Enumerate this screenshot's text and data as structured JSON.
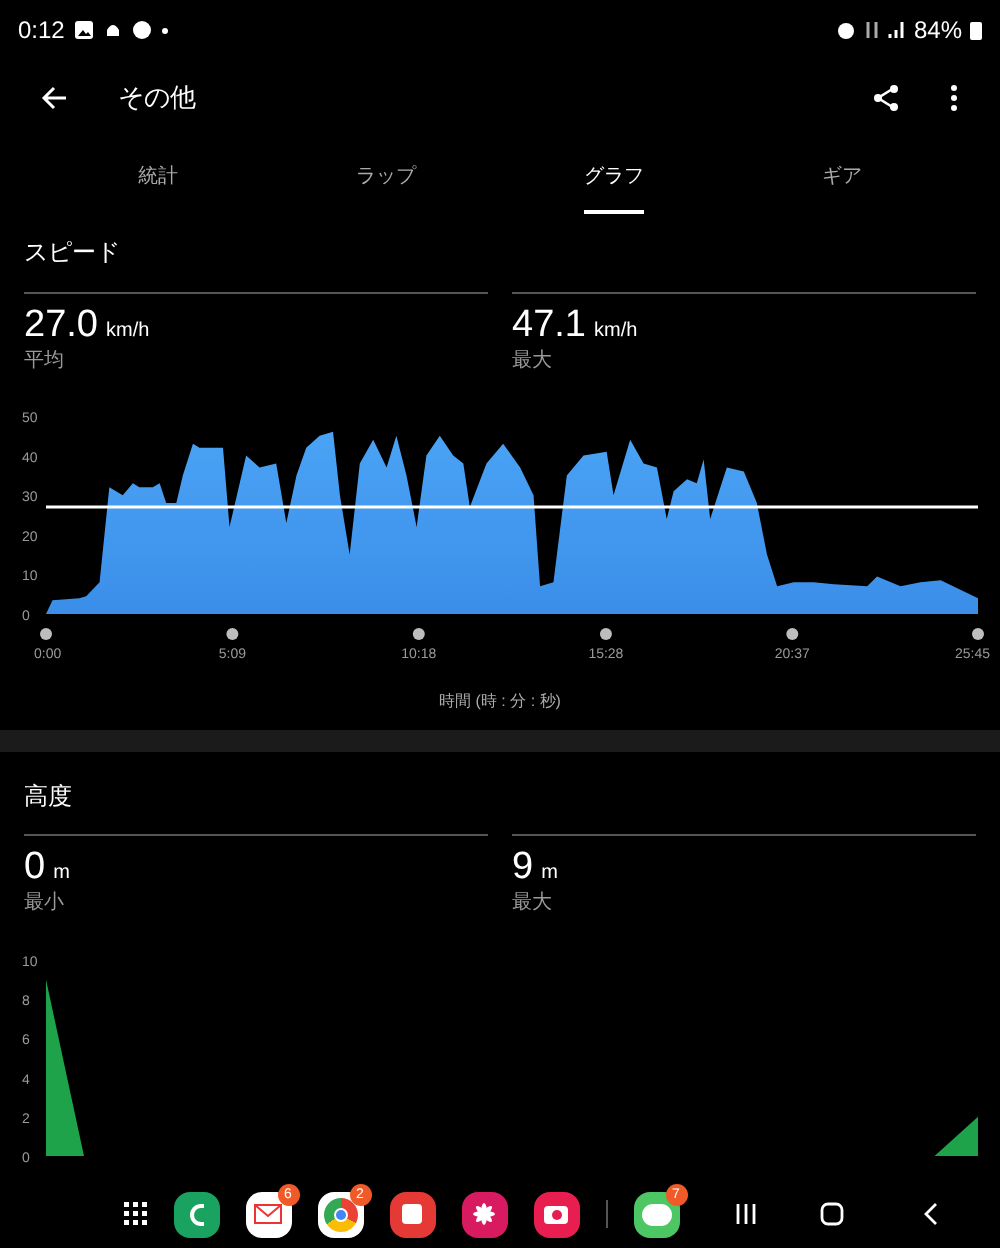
{
  "status_bar": {
    "time": "0:12",
    "battery": "84%"
  },
  "app_bar": {
    "title": "その他"
  },
  "tabs": [
    {
      "label": "統計",
      "selected": false
    },
    {
      "label": "ラップ",
      "selected": false
    },
    {
      "label": "グラフ",
      "selected": true
    },
    {
      "label": "ギア",
      "selected": false
    }
  ],
  "sections": [
    {
      "title": "スピード",
      "stats": [
        {
          "value": "27.0",
          "unit": "km/h",
          "label": "平均"
        },
        {
          "value": "47.1",
          "unit": "km/h",
          "label": "最大"
        }
      ],
      "chart_data": {
        "type": "area",
        "xlabel": "時間 (時 : 分 : 秒)",
        "ylim": [
          0,
          50
        ],
        "xlim": [
          0,
          25.75
        ],
        "yticks": [
          0,
          10,
          20,
          30,
          40,
          50
        ],
        "xticks": [
          {
            "value": 0,
            "label": "0:00"
          },
          {
            "value": 5.15,
            "label": "5:09"
          },
          {
            "value": 10.3,
            "label": "10:18"
          },
          {
            "value": 15.47,
            "label": "15:28"
          },
          {
            "value": 20.62,
            "label": "20:37"
          },
          {
            "value": 25.75,
            "label": "25:45"
          }
        ],
        "ref_lines": [
          {
            "value": 27,
            "axis": "y"
          }
        ],
        "series": [
          {
            "color": "#3b8ee8",
            "x": [
              0,
              0.18,
              0.92,
              1.11,
              1.48,
              1.75,
              2.12,
              2.4,
              2.58,
              2.95,
              3.14,
              3.32,
              3.6,
              3.78,
              4.06,
              4.24,
              4.61,
              4.89,
              5.07,
              5.53,
              5.9,
              6.36,
              6.64,
              6.92,
              7.19,
              7.56,
              7.93,
              8.12,
              8.39,
              8.67,
              9.04,
              9.41,
              9.68,
              9.96,
              10.24,
              10.51,
              10.88,
              11.25,
              11.53,
              11.71,
              12.17,
              12.63,
              13.1,
              13.47,
              13.65,
              14.02,
              14.39,
              14.85,
              15.49,
              15.68,
              16.14,
              16.51,
              16.88,
              17.15,
              17.34,
              17.71,
              17.98,
              18.17,
              18.35,
              18.81,
              19.28,
              19.64,
              19.92,
              20.2,
              20.66,
              21.21,
              21.77,
              22.69,
              22.96,
              23.61,
              24.16,
              24.72,
              25.75
            ],
            "values": [
              0,
              3.5,
              4,
              4.5,
              8,
              32,
              30,
              33,
              32,
              32,
              33,
              28,
              28,
              35,
              43,
              42,
              42,
              42,
              22,
              40,
              37,
              38,
              23,
              35,
              42,
              45,
              46,
              30,
              15,
              38,
              44,
              37,
              45,
              35,
              22,
              40,
              45,
              40,
              38,
              27,
              38,
              43,
              37,
              30,
              7,
              8,
              35,
              40,
              41,
              30,
              44,
              38,
              37,
              24,
              31,
              34,
              33,
              39,
              24,
              37,
              36,
              28,
              15,
              7,
              8,
              8,
              7.5,
              7,
              9.5,
              7,
              8,
              8.5,
              4
            ]
          }
        ]
      }
    },
    {
      "title": "高度",
      "stats": [
        {
          "value": "0",
          "unit": "m",
          "label": "最小"
        },
        {
          "value": "9",
          "unit": "m",
          "label": "最大"
        }
      ],
      "chart_data": {
        "type": "area",
        "ylim": [
          0,
          10
        ],
        "xlim": [
          0,
          25.75
        ],
        "yticks": [
          0,
          2,
          4,
          6,
          8,
          10
        ],
        "series": [
          {
            "color": "#1fa34a",
            "x": [
              0,
              1.05,
              24.55,
              25.75
            ],
            "values": [
              9,
              0,
              0,
              2
            ]
          }
        ]
      }
    }
  ],
  "dock": {
    "badges": [
      {
        "count": "6"
      },
      {
        "count": "2"
      },
      {
        "count": "7"
      }
    ]
  }
}
